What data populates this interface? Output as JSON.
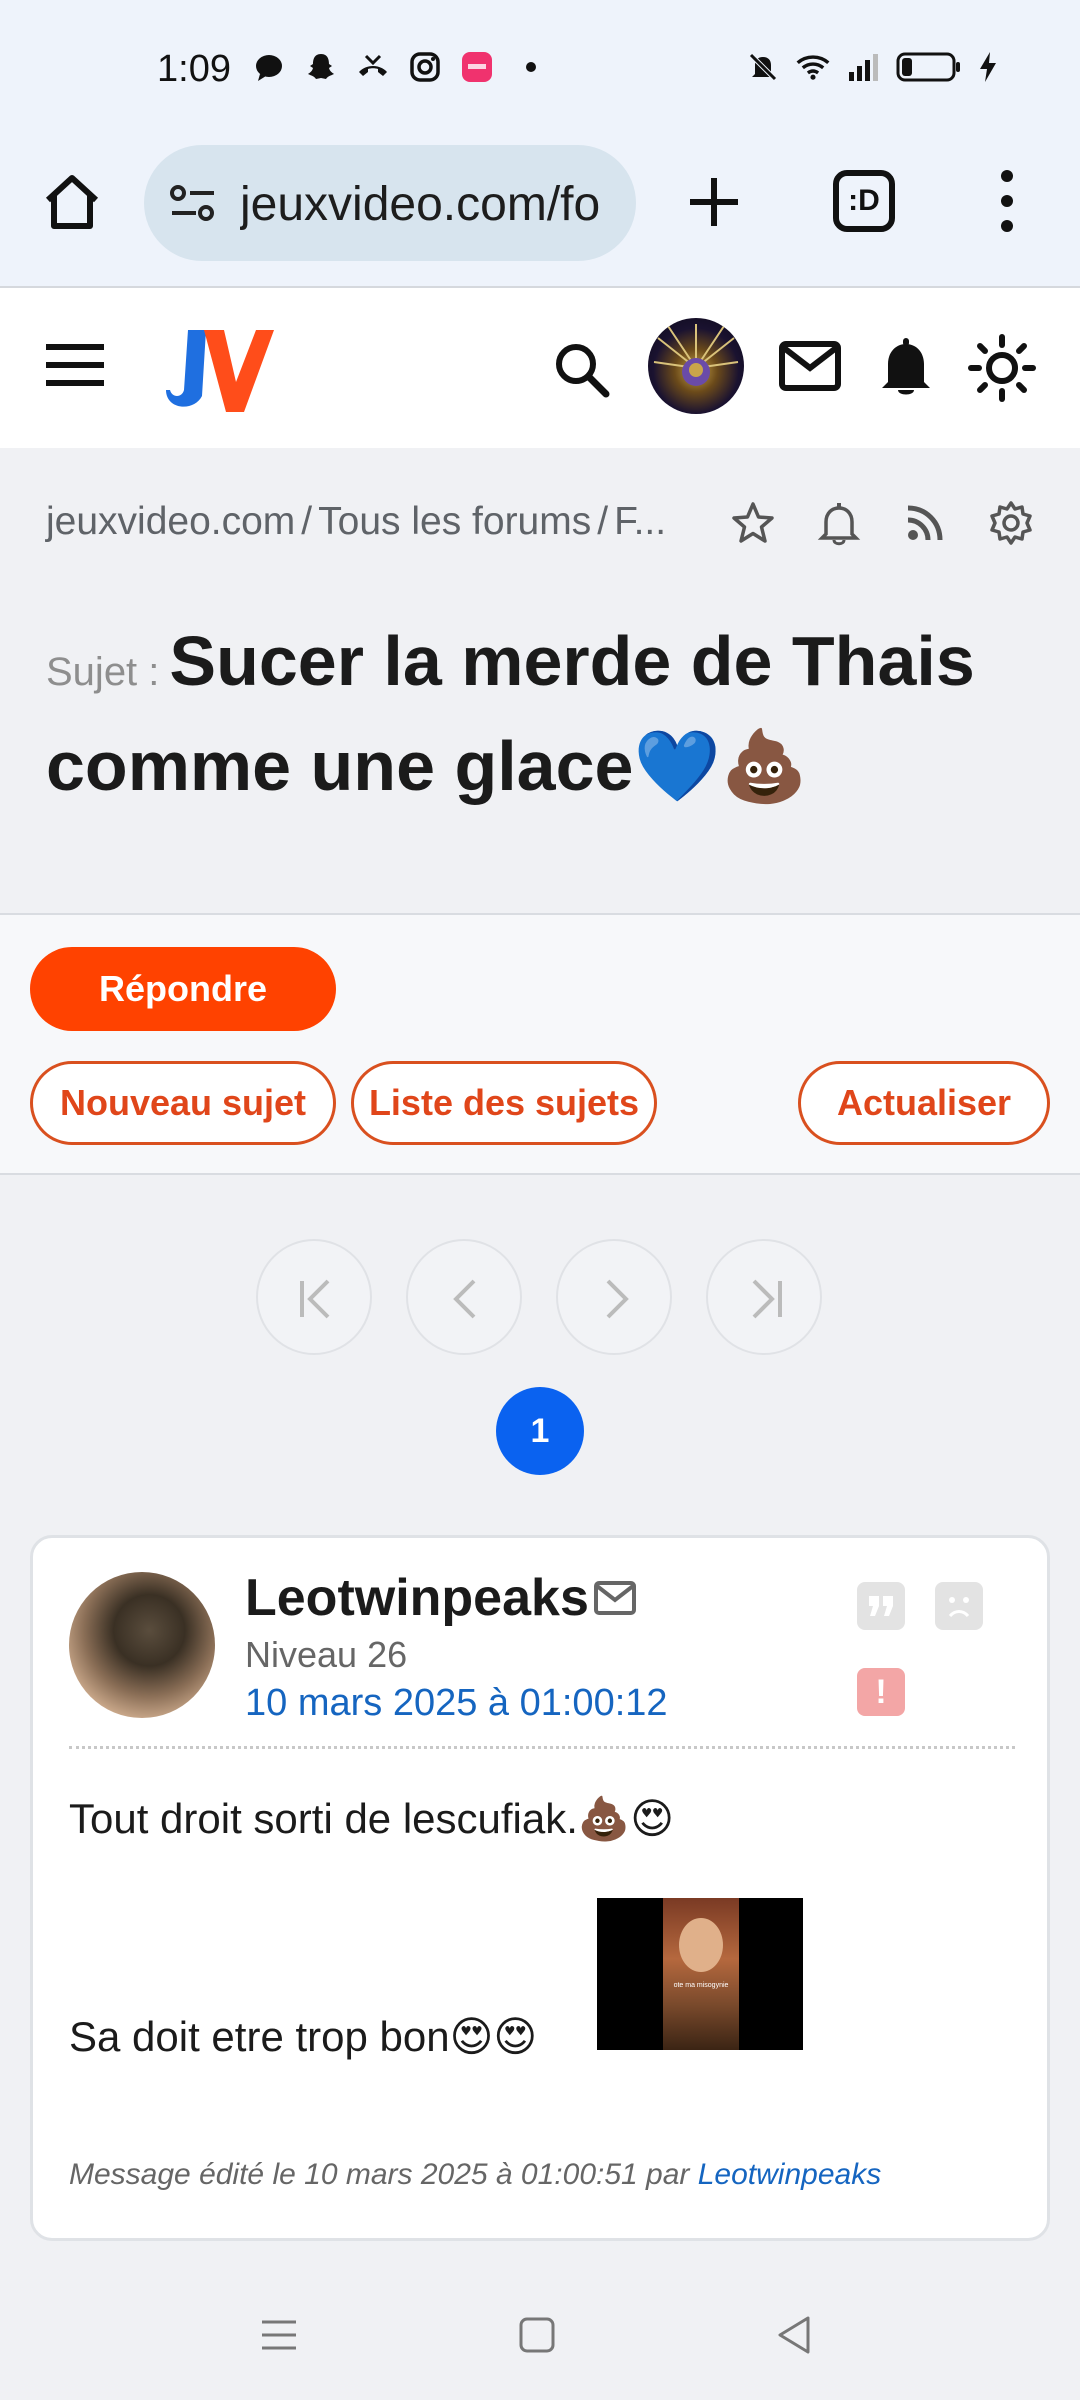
{
  "status_bar": {
    "time": "1:09",
    "left_icons": [
      "chat-bubble-icon",
      "snapchat-icon",
      "missed-call-icon",
      "instagram-icon",
      "app-badge-icon"
    ],
    "right_icons": [
      "mute-icon",
      "wifi-icon",
      "signal-icon",
      "battery-icon",
      "charging-icon"
    ]
  },
  "browser": {
    "url": "jeuxvideo.com/fo",
    "tabs_label": ":D"
  },
  "site_header": {
    "logo_text": "JV"
  },
  "breadcrumb": {
    "items": [
      "jeuxvideo.com",
      "/",
      "Tous les forums",
      "/",
      "F..."
    ]
  },
  "topic": {
    "label": "Sujet :",
    "title": "Sucer la merde de Thais comme une glace💙💩"
  },
  "actions": {
    "reply": "Répondre",
    "new_topic": "Nouveau sujet",
    "topic_list": "Liste des sujets",
    "refresh": "Actualiser"
  },
  "pagination": {
    "current_page": "1"
  },
  "message": {
    "author": "Leotwinpeaks",
    "level": "Niveau 26",
    "date": "10 mars 2025 à 01:00:12",
    "line1": "Tout droit sorti de lescufiak.💩😍",
    "line2": "Sa doit etre trop bon😍😍",
    "image_caption": "ote ma misogynie",
    "edited_prefix": "Message édité le 10 mars 2025 à 01:00:51 par",
    "edited_by": "Leotwinpeaks"
  },
  "colors": {
    "accent_orange": "#ff4200",
    "link_blue": "#1565c0",
    "page_blue": "#0a62f0"
  }
}
